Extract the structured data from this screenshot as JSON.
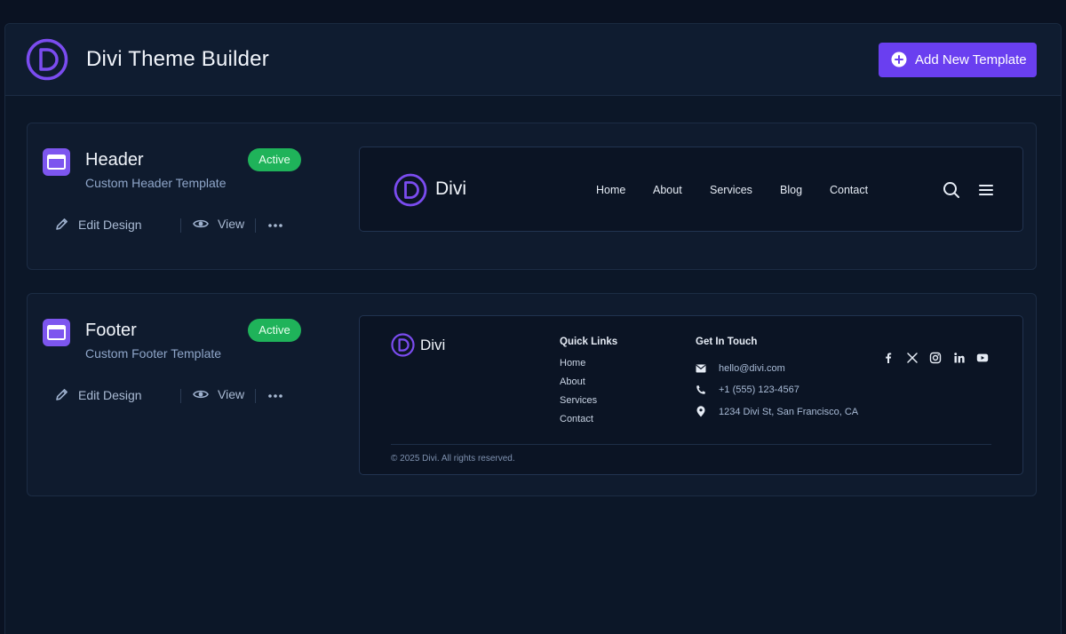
{
  "topbar": {
    "title": "Divi Theme Builder",
    "add_button_label": "Add New Template"
  },
  "templates": [
    {
      "name": "Header",
      "subtitle": "Custom Header Template",
      "status": "Active",
      "actions": {
        "edit": "Edit Design",
        "view": "View"
      }
    },
    {
      "name": "Footer",
      "subtitle": "Custom Footer Template",
      "status": "Active",
      "actions": {
        "edit": "Edit Design",
        "view": "View"
      }
    }
  ],
  "header_preview": {
    "brand": "Divi",
    "nav": [
      "Home",
      "About",
      "Services",
      "Blog",
      "Contact"
    ]
  },
  "footer_preview": {
    "brand": "Divi",
    "quick_links_heading": "Quick Links",
    "quick_links": [
      "Home",
      "About",
      "Services",
      "Contact"
    ],
    "contact_heading": "Get In Touch",
    "email": "hello@divi.com",
    "phone": "+1 (555) 123-4567",
    "address": "1234 Divi St, San Francisco, CA",
    "social_icons": [
      "facebook-icon",
      "x-icon",
      "instagram-icon",
      "linkedin-icon",
      "youtube-icon"
    ],
    "copyright": "© 2025 Divi. All rights reserved."
  },
  "colors": {
    "accent": "#6a3ff0",
    "logo_purple": "#7b4cf0",
    "active_badge": "#1fb35a",
    "background": "#0a1222"
  }
}
